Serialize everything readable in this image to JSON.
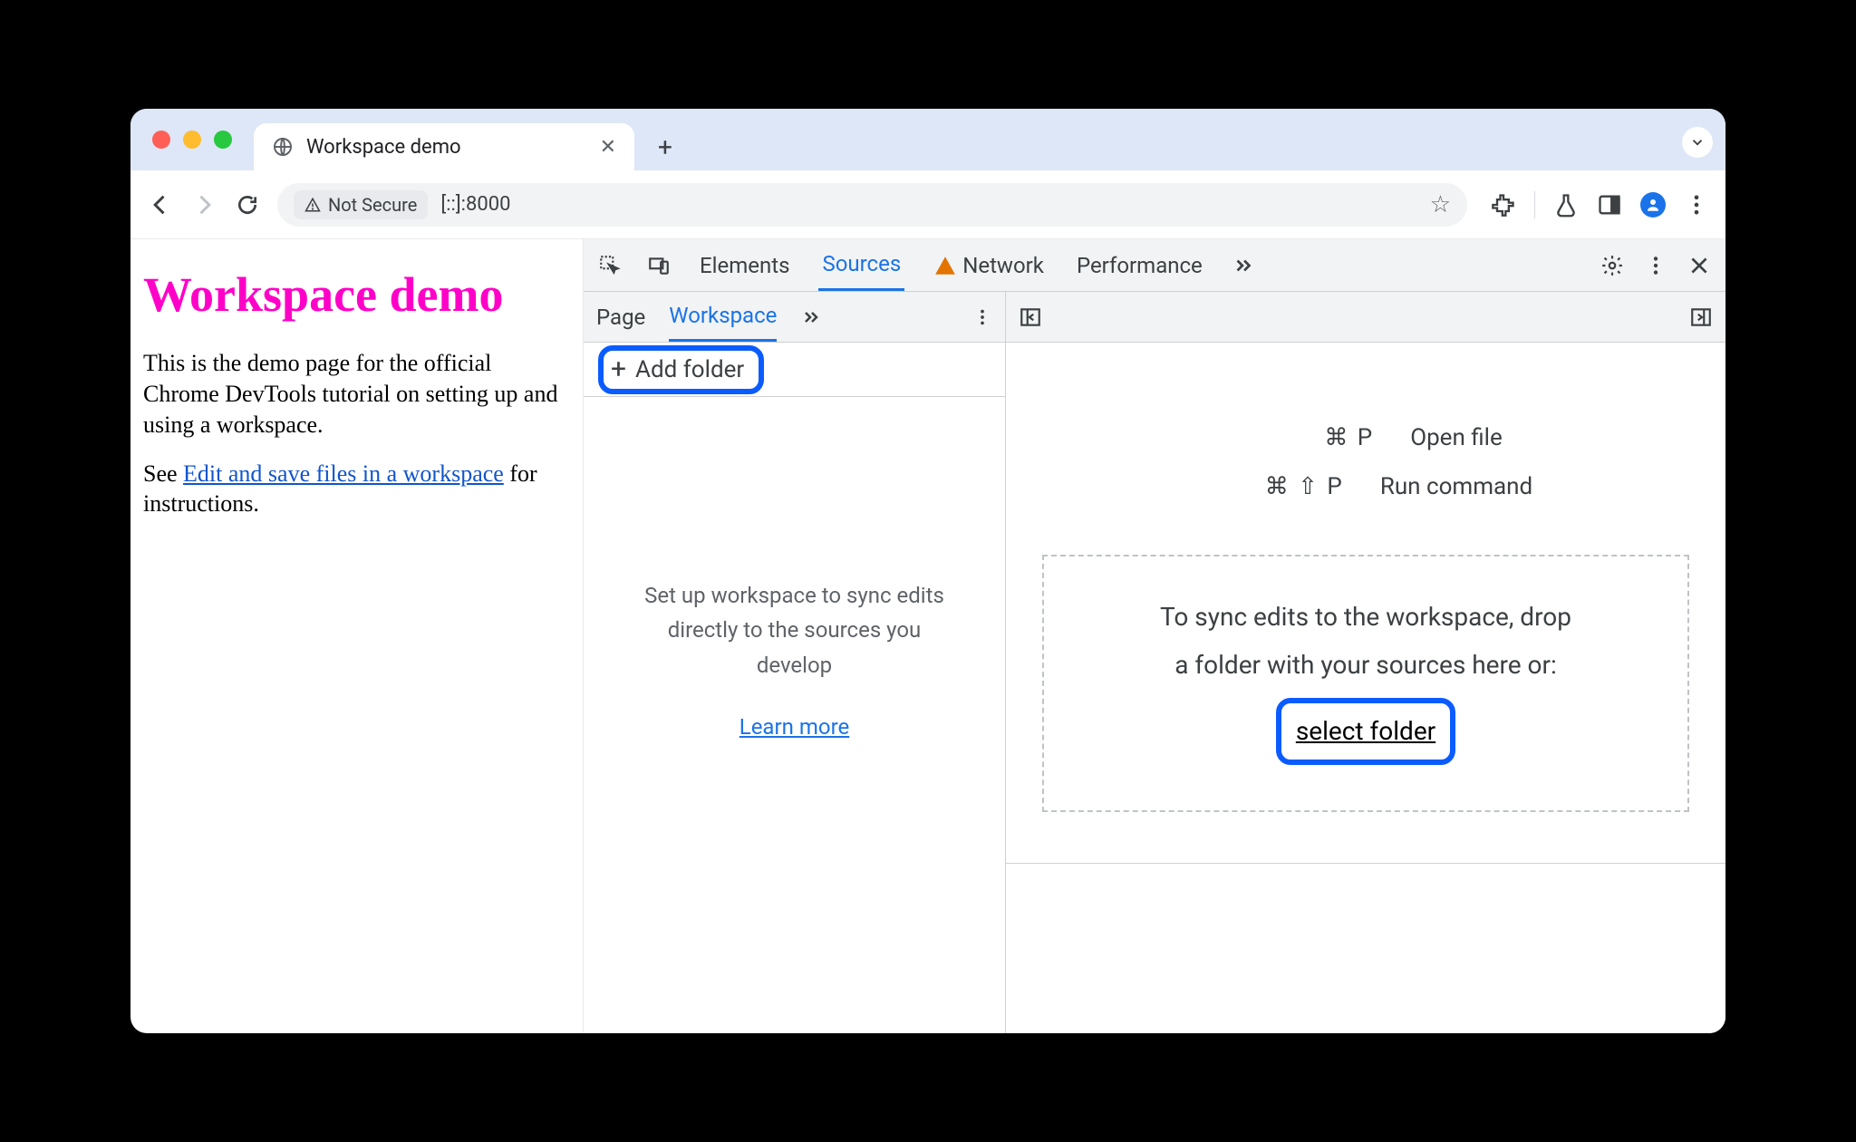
{
  "chrome": {
    "tab_title": "Workspace demo",
    "address": {
      "not_secure_label": "Not Secure",
      "url": "[::]:8000"
    }
  },
  "page": {
    "heading": "Workspace demo",
    "para1": "This is the demo page for the official Chrome DevTools tutorial on setting up and using a workspace.",
    "para2_pre": "See ",
    "link_text": "Edit and save files in a workspace",
    "para2_post": " for instructions."
  },
  "devtools": {
    "top_tabs": {
      "elements": "Elements",
      "sources": "Sources",
      "network": "Network",
      "performance": "Performance"
    },
    "left_tabs": {
      "page": "Page",
      "workspace": "Workspace"
    },
    "add_folder_label": "Add folder",
    "left_hint": "Set up workspace to sync edits directly to the sources you develop",
    "learn_more": "Learn more",
    "shortcuts": {
      "open_file_keys": "⌘  P",
      "open_file_label": "Open file",
      "run_cmd_keys": "⌘  ⇧  P",
      "run_cmd_label": "Run command"
    },
    "dropzone": {
      "line1": "To sync edits to the workspace, drop",
      "line2": "a folder with your sources here or:",
      "select_folder": "select folder"
    }
  }
}
